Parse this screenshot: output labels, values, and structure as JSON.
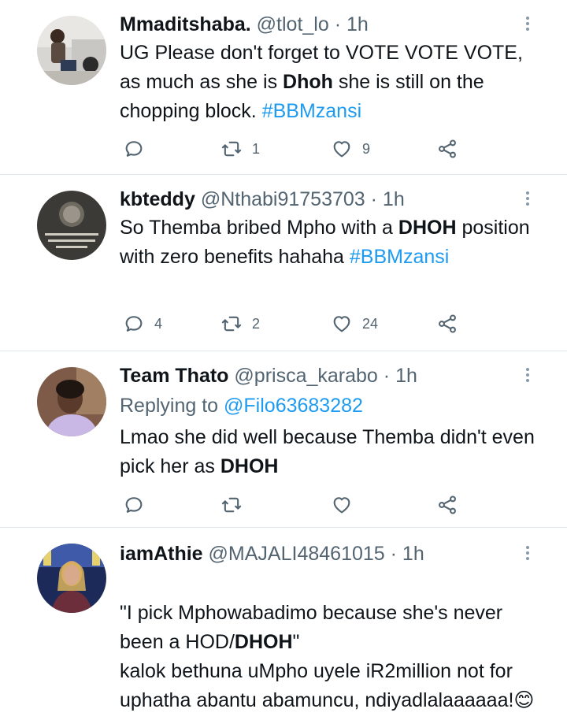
{
  "tweets": [
    {
      "avatar": "avatar-photo",
      "name": "Mmaditshaba.",
      "handle": "@tlot_lo",
      "time": "1h",
      "text": [
        {
          "t": "UG Please don't forget to VOTE VOTE VOTE, as much as she is "
        },
        {
          "t": "Dhoh",
          "hl": true
        },
        {
          "t": " she is still on the chopping block. "
        },
        {
          "t": "#BBMzansi",
          "tag": true
        }
      ],
      "replies": "",
      "retweets": "1",
      "likes": "9"
    },
    {
      "avatar": "avatar-quote",
      "name": "kbteddy",
      "handle": "@Nthabi91753703",
      "time": "1h",
      "text": [
        {
          "t": "So Themba bribed Mpho with a "
        },
        {
          "t": "DHOH",
          "hl": true
        },
        {
          "t": " position with zero benefits  hahaha "
        },
        {
          "t": "#BBMzansi",
          "tag": true
        }
      ],
      "replies": "4",
      "retweets": "2",
      "likes": "24"
    },
    {
      "avatar": "avatar-photo",
      "name": "Team Thato",
      "handle": "@prisca_karabo",
      "time": "1h",
      "replying_label": "Replying to ",
      "replying_handle": "@Filo63683282",
      "text": [
        {
          "t": "Lmao she did well because Themba didn't even pick her as "
        },
        {
          "t": "DHOH",
          "hl": true
        }
      ],
      "replies": "",
      "retweets": "",
      "likes": ""
    },
    {
      "avatar": "avatar-photo",
      "name": "iamAthie",
      "handle": "@MAJALI48461015",
      "time": "1h",
      "text": [
        {
          "t": "\"I pick Mphowabadimo because she's never been a HOD/"
        },
        {
          "t": "DHOH",
          "hl": true
        },
        {
          "t": "\"\nkalok bethuna uMpho uyele iR2million not for uphatha abantu abamuncu, ndiyadlalaaaaaa!😊"
        }
      ],
      "replies": "",
      "retweets": "",
      "likes": ""
    }
  ],
  "colors": {
    "text": "#0f1419",
    "secondary": "#536471",
    "link": "#1d9bf0",
    "divider": "#e1e8ed"
  }
}
